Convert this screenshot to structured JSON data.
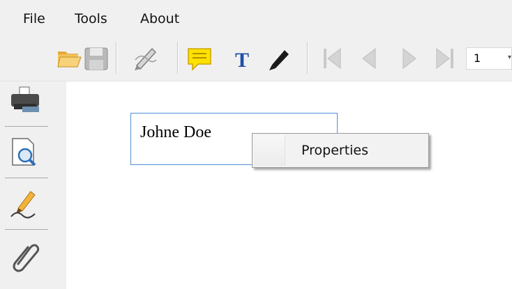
{
  "menubar": {
    "items": [
      "File",
      "Tools",
      "About"
    ]
  },
  "toolbar": {
    "icons": [
      "open-folder-icon",
      "save-icon",
      "sign-icon",
      "comment-icon",
      "text-icon",
      "pen-icon",
      "first-page-icon",
      "previous-page-icon",
      "next-page-icon",
      "last-page-icon"
    ],
    "page_number": "1"
  },
  "sidebar": {
    "icons": [
      "print-icon",
      "zoom-preview-icon",
      "signature-icon",
      "attachment-icon"
    ]
  },
  "document": {
    "textbox_value": "Johne Doe"
  },
  "context_menu": {
    "items": [
      "Properties"
    ]
  }
}
